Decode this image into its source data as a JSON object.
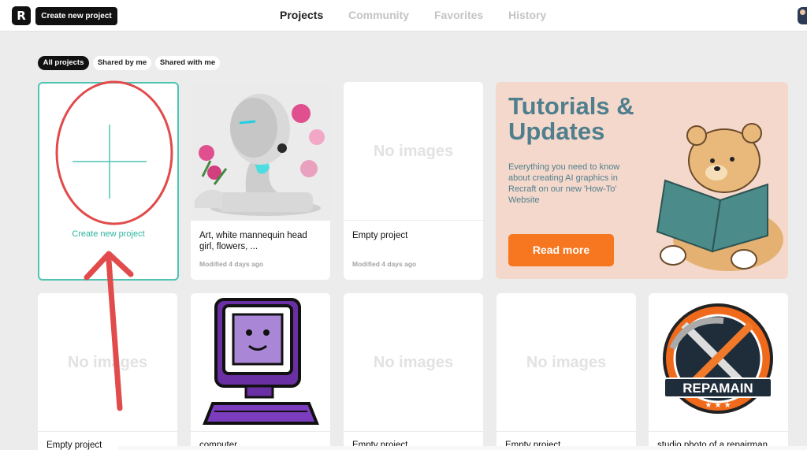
{
  "topbar": {
    "logo_text": "R",
    "create_button": "Create new project",
    "nav": [
      "Projects",
      "Community",
      "Favorites",
      "History"
    ]
  },
  "filters": [
    "All projects",
    "Shared by me",
    "Shared with me"
  ],
  "new_project": {
    "label": "Create new project"
  },
  "projects_row1": [
    {
      "title": "Art, white mannequin head girl, flowers, ...",
      "meta": "Modified 4 days ago"
    },
    {
      "placeholder": "No images",
      "title": "Empty project",
      "meta": "Modified 4 days ago"
    }
  ],
  "tutorial": {
    "title": "Tutorials & Updates",
    "description": "Everything you need to know about creating AI graphics in Recraft on our new 'How-To' Website",
    "button": "Read more"
  },
  "projects_row2": [
    {
      "placeholder": "No images",
      "title": "Empty project"
    },
    {
      "title": "computer"
    },
    {
      "placeholder": "No images",
      "title": "Empty project"
    },
    {
      "placeholder": "No images",
      "title": "Empty project"
    },
    {
      "title": "studio photo of a repairman",
      "logo_text": "REPAMAIN"
    }
  ],
  "colors": {
    "accent_teal": "#4fc4b2",
    "annotation_red": "#e14b4b",
    "read_more_orange": "#f77720",
    "tutorial_bg": "#f5d8cc"
  }
}
